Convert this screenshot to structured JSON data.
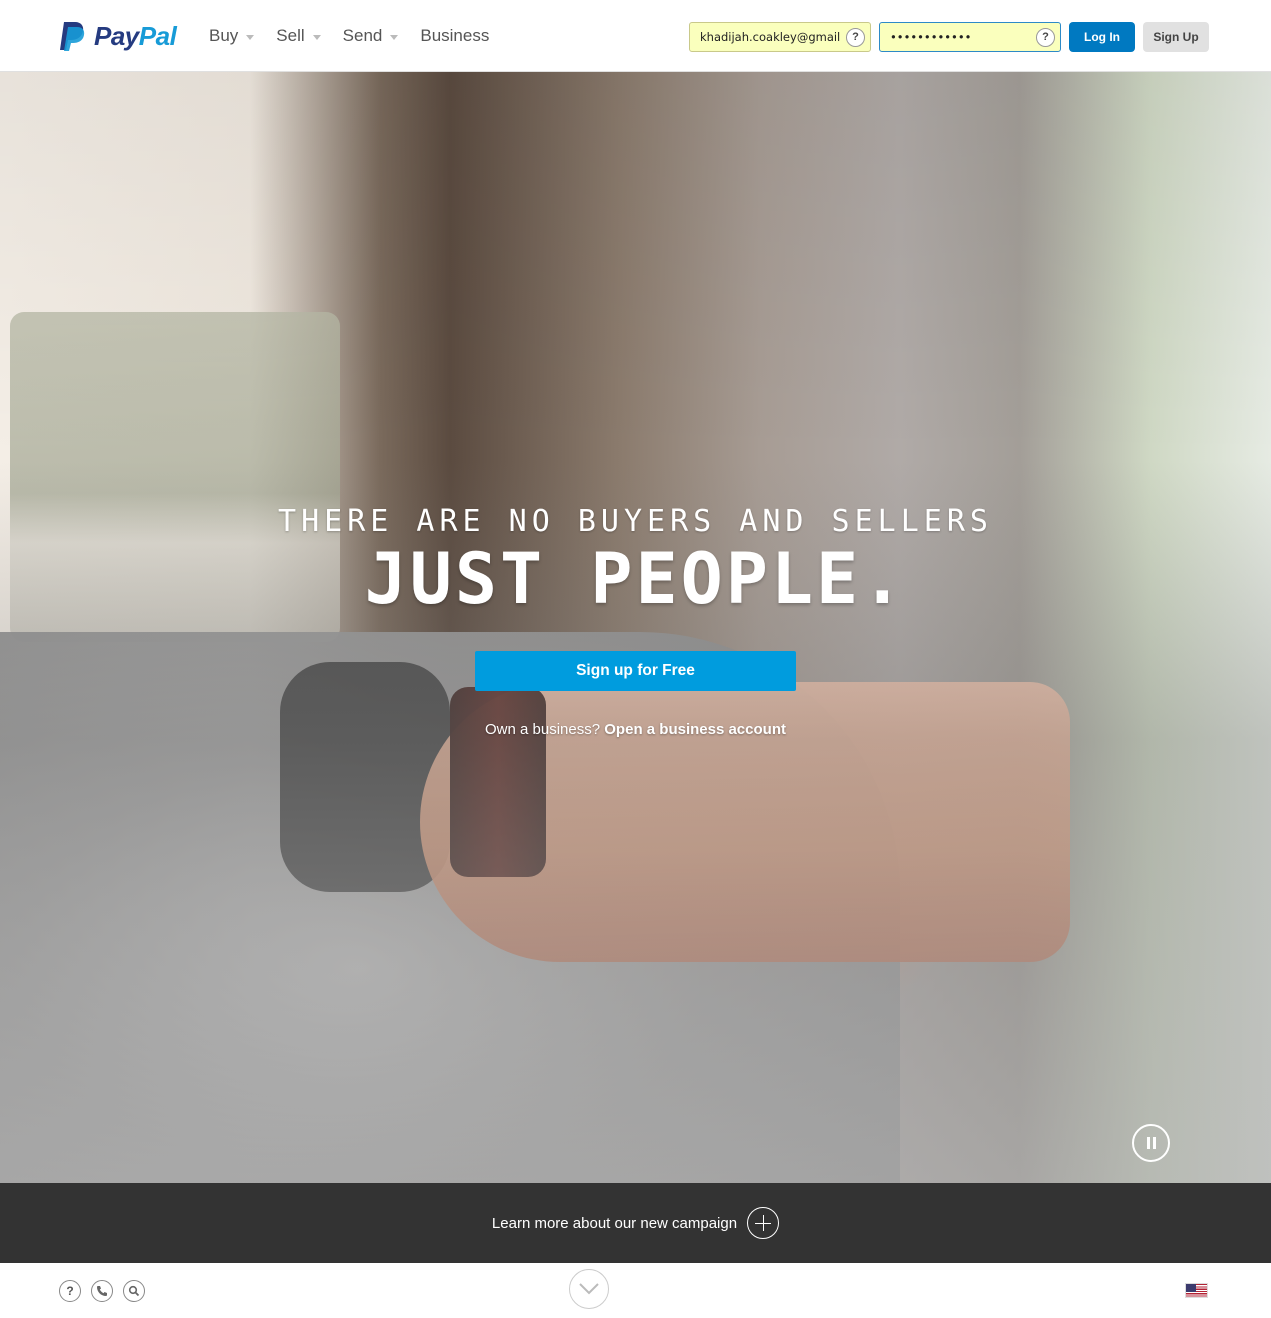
{
  "header": {
    "brand": {
      "pay": "Pay",
      "pal": "Pal"
    },
    "nav": [
      {
        "label": "Buy",
        "dropdown": true
      },
      {
        "label": "Sell",
        "dropdown": true
      },
      {
        "label": "Send",
        "dropdown": true
      },
      {
        "label": "Business",
        "dropdown": false
      }
    ],
    "login": {
      "email_value": "khadijah.coakley@gmail...",
      "password_value": "••••••••••••",
      "help_label": "?",
      "login_label": "Log In",
      "signup_label": "Sign Up"
    }
  },
  "hero": {
    "tagline": "THERE ARE NO BUYERS AND SELLERS",
    "headline": "JUST PEOPLE.",
    "cta_label": "Sign up for Free",
    "business_prompt": "Own a business?",
    "business_link": "Open a business account"
  },
  "campaign": {
    "text": "Learn more about our new campaign"
  },
  "footer": {
    "icons": [
      "help-icon",
      "phone-icon",
      "search-icon"
    ],
    "help_symbol": "?"
  },
  "colors": {
    "primary_blue": "#0079c1",
    "cta_blue": "#009cde",
    "dark_bar": "#333333",
    "brand_navy": "#253b80",
    "brand_light": "#179bd7",
    "autofill_yellow": "#faffbd"
  }
}
